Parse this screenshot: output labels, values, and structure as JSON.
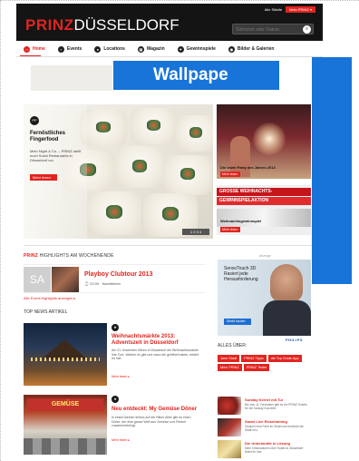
{
  "header": {
    "logo_brand": "PRINZ",
    "logo_city": "DÜSSELDORF",
    "top_link": "Alle Städte",
    "account_button": "Mein PRINZ ▾",
    "search_placeholder": "Stichwort oder Datum"
  },
  "nav": {
    "items": [
      {
        "label": "Home",
        "active": true
      },
      {
        "label": "Events",
        "active": false
      },
      {
        "label": "Locations",
        "active": false
      },
      {
        "label": "Magazin",
        "active": false
      },
      {
        "label": "Gewinnspiele",
        "active": false
      },
      {
        "label": "Bilder & Galerien",
        "active": false
      }
    ]
  },
  "wallpaper": {
    "label": "Wallpape",
    "color": "#1874d8"
  },
  "hero": {
    "badge": "PP",
    "title": "Fernöstliches Fingerfood",
    "text": "Mein Night & Co. – PRINZ stellt euch Sushi Restaurants in Düsseldorf vor.",
    "button": "Mehr lesen",
    "pager": "1 2 3 4"
  },
  "teasers": {
    "first_caption": "Die letzte Party des Jahres 2013",
    "first_button": "Mehr lesen",
    "second_strip1": "GROSSE WEIHNACHTS-",
    "second_strip2": "GEWINNSPIELAKTION",
    "second_caption": "Weihnachtsgewinnspiel",
    "second_button": "Mehr lesen"
  },
  "highlights": {
    "brand": "PRINZ",
    "title": " HIGHLIGHTS AM WOCHENENDE",
    "day": "SA",
    "event_name": "Playboy Clubtour 2013",
    "event_meta": "⌚ 22:00 · Nachtleben",
    "more_link": "Alle Event-Highlights anzeigen ▸"
  },
  "ad": {
    "label": "Anzeige",
    "title": "SensoTouch 3D Rasiert jede Herausforderung",
    "button": "Direkt kaufen",
    "logo": "PHILIPS"
  },
  "news": {
    "section_title": "TOP NEWS ARTIKEL",
    "items": [
      {
        "headline": "Weihnachtsmärkte 2013: Adventszeit in Düsseldorf",
        "text": "Am 21. November öffnen in Düsseldorf die Weihnachtsmärkte ihre Tore. Welche es gibt und wann sie geöffnet haben, erfahrt ihr hier.",
        "more": "Mehr lesen ▸"
      },
      {
        "headline": "Neu entdeckt: My Gemüse Döner",
        "text": "In einem kleinen Imbiss auf der Bilker Allee gibt es einen Döner, der eine ganze Welt aus Gemüse und Fleisch zusammenbringt.",
        "more": "Mehr lesen ▸"
      }
    ],
    "sign_text": "GEMÜSE"
  },
  "alles_ueber": {
    "title": "ALLES ÜBER:",
    "tags": [
      "Jane Stadt",
      "PRINZ Tipps",
      "die Top Guide App",
      "Mein PRINZ",
      "PRINZ Tester"
    ]
  },
  "side_items": [
    {
      "headline": "Sunday Kernel mit Tui",
      "text": "Bis zum 11. Dezember gibt es bei PRINZ Tickets für die Sunday Konzerte."
    },
    {
      "headline": "Smart Live Reisetraining",
      "text": "Gewinnt eine Fahrt im Smart und entdeckt die Stadt neu."
    },
    {
      "headline": "Die Unterkünfte in Lösung",
      "text": "Mehr Informationen über Hotels in Düsseldorf findet ihr hier."
    }
  ]
}
